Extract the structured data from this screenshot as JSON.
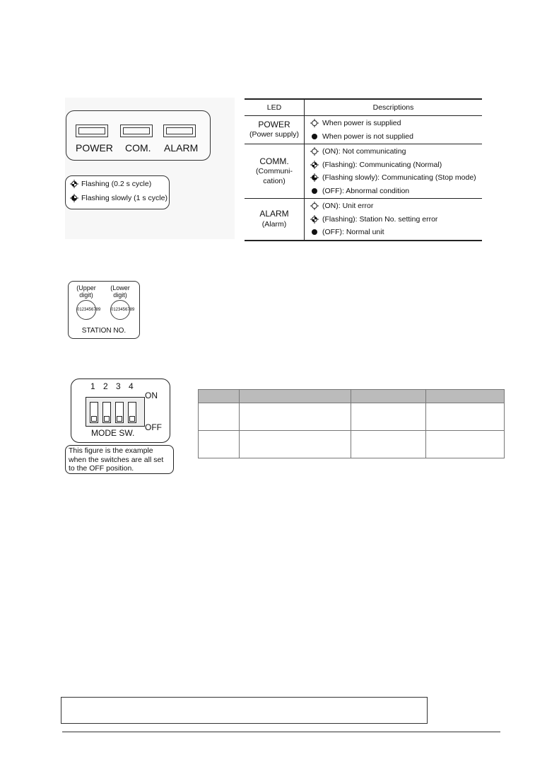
{
  "led_panel": {
    "labels": [
      "POWER",
      "COM.",
      "ALARM"
    ]
  },
  "legend": {
    "items": [
      {
        "icon": "led-flashing-icon",
        "text": "Flashing (0.2 s cycle)"
      },
      {
        "icon": "led-flashing-slowly-icon",
        "text": "Flashing slowly (1 s cycle)"
      }
    ]
  },
  "led_table": {
    "headers": [
      "LED",
      "Descriptions"
    ],
    "rows": [
      {
        "led": [
          "POWER",
          "(Power supply)"
        ],
        "items": [
          {
            "icon": "on",
            "text": "When power is supplied"
          },
          {
            "icon": "off",
            "text": "When power is not supplied"
          }
        ]
      },
      {
        "led": [
          "COMM.",
          "(Communi-",
          "cation)"
        ],
        "items": [
          {
            "icon": "on",
            "text": "(ON): Not communicating"
          },
          {
            "icon": "flash",
            "text": "(Flashing): Communicating (Normal)"
          },
          {
            "icon": "slow",
            "text": "(Flashing slowly): Communicating (Stop mode)"
          },
          {
            "icon": "off",
            "text": "(OFF): Abnormal condition"
          }
        ]
      },
      {
        "led": [
          "ALARM",
          "(Alarm)"
        ],
        "items": [
          {
            "icon": "on",
            "text": "(ON): Unit error"
          },
          {
            "icon": "flash",
            "text": "(Flashing): Station No. setting error"
          },
          {
            "icon": "off",
            "text": "(OFF): Normal unit"
          }
        ]
      }
    ]
  },
  "station": {
    "upper": "(Upper digit)",
    "lower": "(Lower digit)",
    "dial_digits": "0123456789",
    "title": "STATION NO."
  },
  "mode_switch": {
    "numbers": [
      "1",
      "2",
      "3",
      "4"
    ],
    "on": "ON",
    "off": "OFF",
    "title": "MODE SW.",
    "note": "This figure is the example when the switches are all set to the OFF position."
  }
}
